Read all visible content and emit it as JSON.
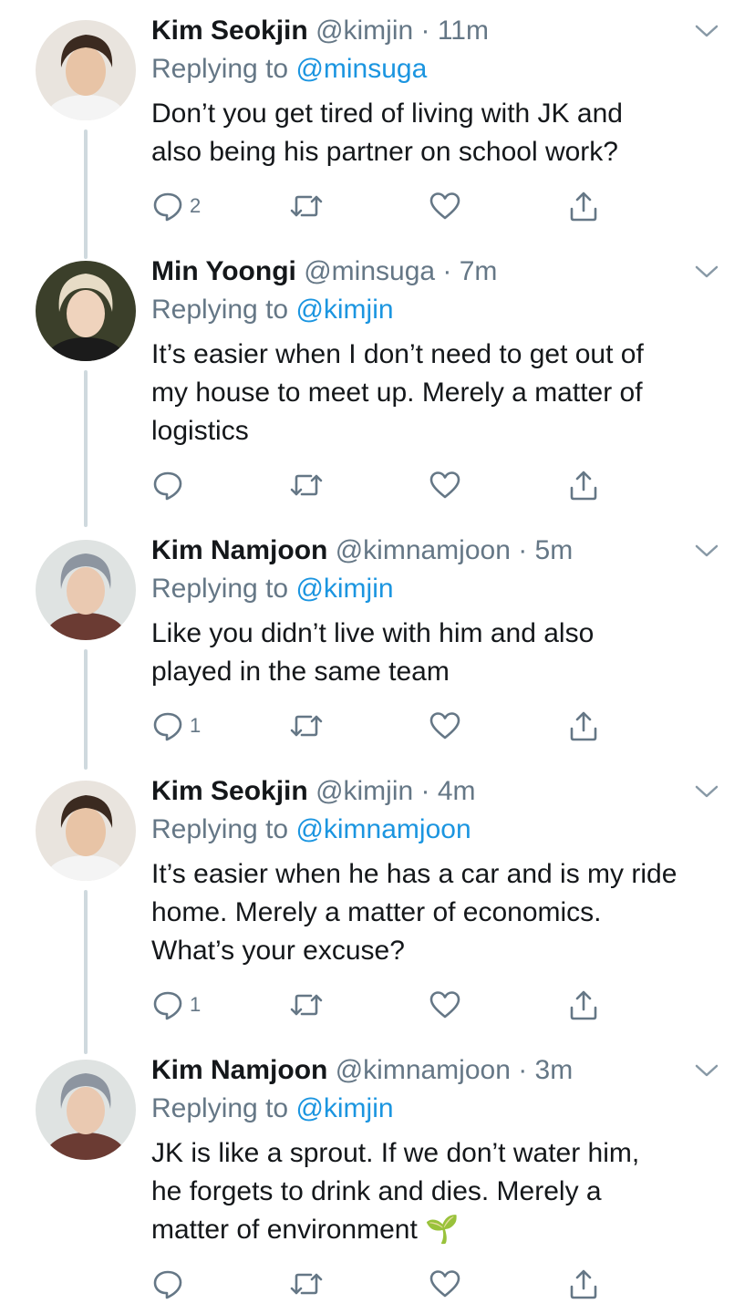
{
  "colors": {
    "text": "#14171a",
    "secondary": "#657786",
    "link": "#1b95e0",
    "connector": "#cfd9de",
    "background": "#ffffff"
  },
  "tweets": [
    {
      "name": "Kim Seokjin",
      "meta": "@kimjin · 11m",
      "replying_prefix": "Replying to",
      "replying_handle": "@minsuga",
      "lines": [
        "Don’t you get tired of living with JK and",
        "also being his partner on school work?"
      ],
      "reply_count": "2",
      "avatar_icon": "avatar-seokjin"
    },
    {
      "name": "Min Yoongi",
      "meta": "@minsuga · 7m",
      "replying_prefix": "Replying to",
      "replying_handle": "@kimjin",
      "lines": [
        "It’s easier when I don’t need to get out of",
        "my house to meet up. Merely a matter of",
        "logistics"
      ],
      "reply_count": "",
      "avatar_icon": "avatar-yoongi"
    },
    {
      "name": "Kim Namjoon",
      "meta": "@kimnamjoon · 5m",
      "replying_prefix": "Replying to",
      "replying_handle": "@kimjin",
      "lines": [
        "Like you didn’t live with him and also",
        "played in the same team"
      ],
      "reply_count": "1",
      "avatar_icon": "avatar-namjoon"
    },
    {
      "name": "Kim Seokjin",
      "meta": "@kimjin · 4m",
      "replying_prefix": "Replying to",
      "replying_handle": "@kimnamjoon",
      "lines": [
        "It’s easier when he has a car and is my ride",
        "home. Merely a matter of economics.",
        "What’s your excuse?"
      ],
      "reply_count": "1",
      "avatar_icon": "avatar-seokjin"
    },
    {
      "name": "Kim Namjoon",
      "meta": "@kimnamjoon · 3m",
      "replying_prefix": "Replying to",
      "replying_handle": "@kimjin",
      "lines": [
        "JK is like a sprout. If we don’t water him,",
        "he forgets to drink and dies. Merely a",
        "matter of environment 🌱"
      ],
      "reply_count": "",
      "avatar_icon": "avatar-namjoon"
    }
  ]
}
